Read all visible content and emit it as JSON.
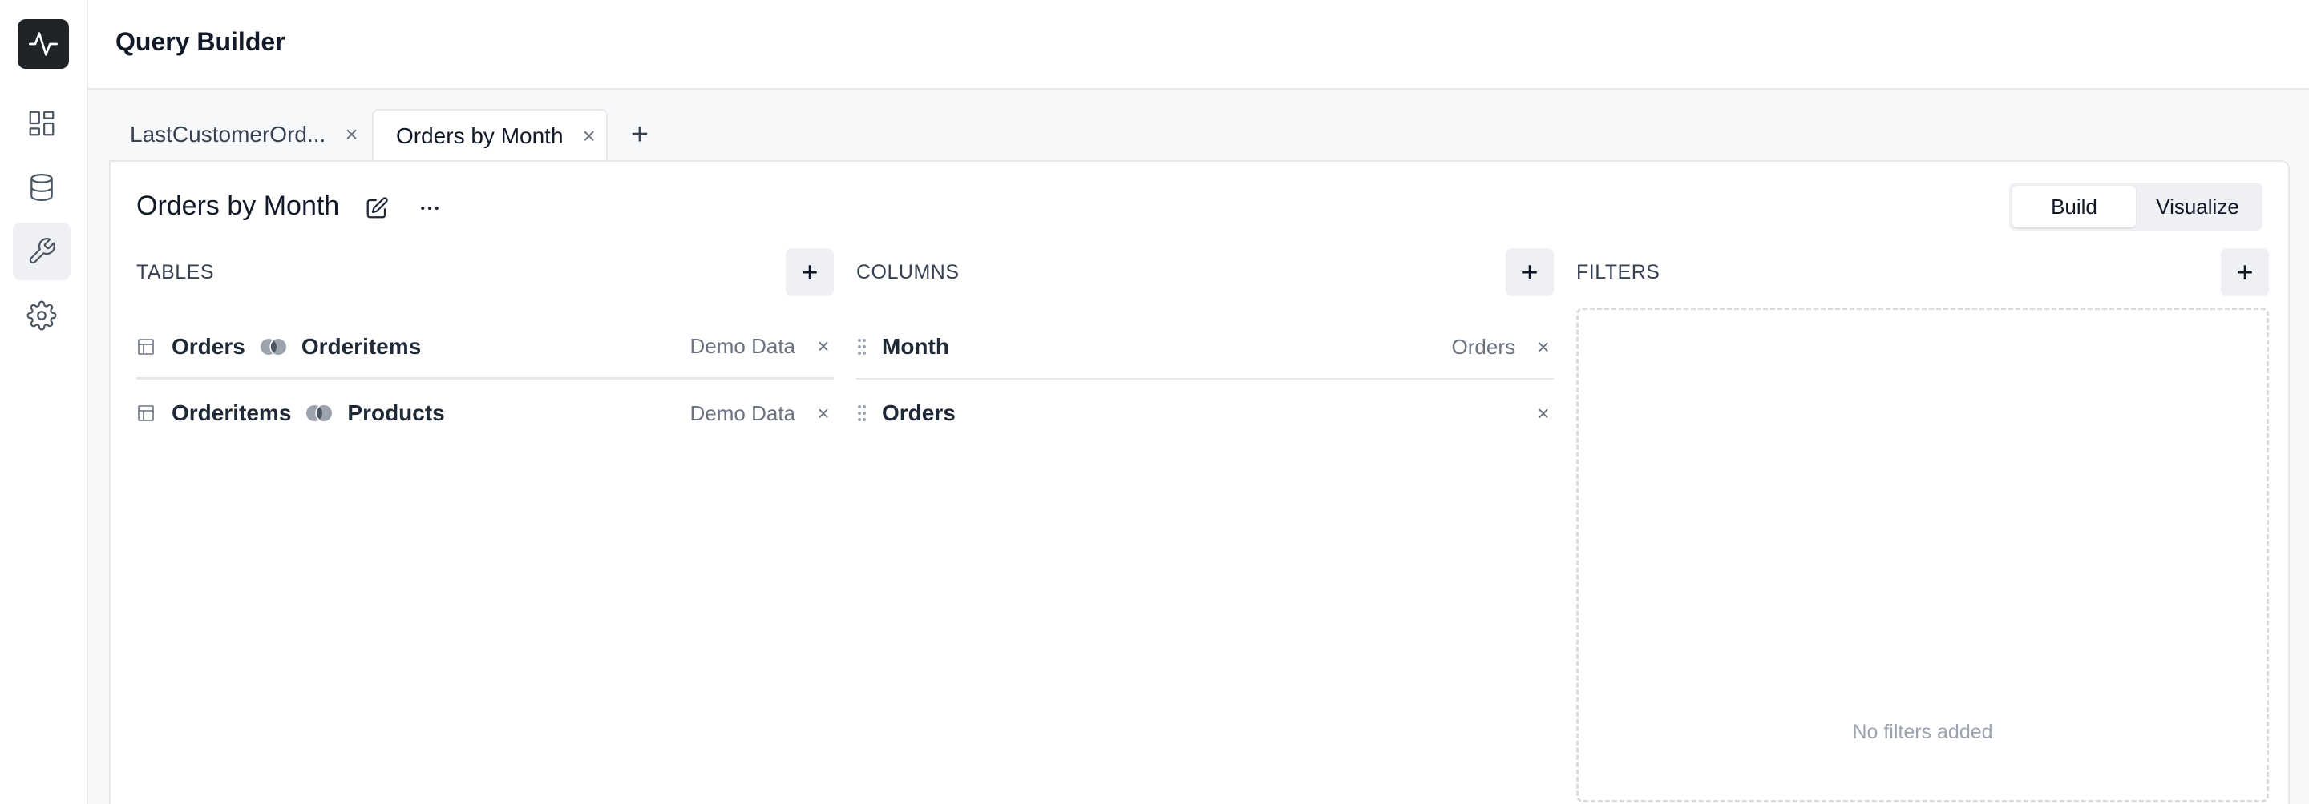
{
  "header": {
    "title": "Query Builder"
  },
  "sidebar": {
    "items": [
      {
        "name": "dashboard-icon"
      },
      {
        "name": "database-icon"
      },
      {
        "name": "wrench-icon",
        "active": true
      },
      {
        "name": "gear-icon"
      }
    ]
  },
  "tabs": [
    {
      "label": "LastCustomerOrd...",
      "active": false,
      "close": "×"
    },
    {
      "label": "Orders by Month",
      "active": true,
      "close": "×"
    }
  ],
  "tab_add": "+",
  "query": {
    "title": "Orders by Month",
    "mode_options": [
      "Build",
      "Visualize"
    ],
    "mode_selected": "Build"
  },
  "tables": {
    "title": "TABLES",
    "add": "+",
    "rows": [
      {
        "left": "Orders",
        "right": "Orderitems",
        "source": "Demo Data",
        "remove": "×"
      },
      {
        "left": "Orderitems",
        "right": "Products",
        "source": "Demo Data",
        "remove": "×"
      }
    ]
  },
  "columns": {
    "title": "COLUMNS",
    "add": "+",
    "rows": [
      {
        "name": "Month",
        "source": "Orders",
        "remove": "×"
      },
      {
        "name": "Orders",
        "source": "",
        "remove": "×"
      }
    ]
  },
  "filters": {
    "title": "FILTERS",
    "add": "+",
    "empty": "No filters added"
  },
  "colors": {
    "accent_dark": "#1f2327",
    "border": "#e5e7eb",
    "muted": "#6b7280"
  }
}
